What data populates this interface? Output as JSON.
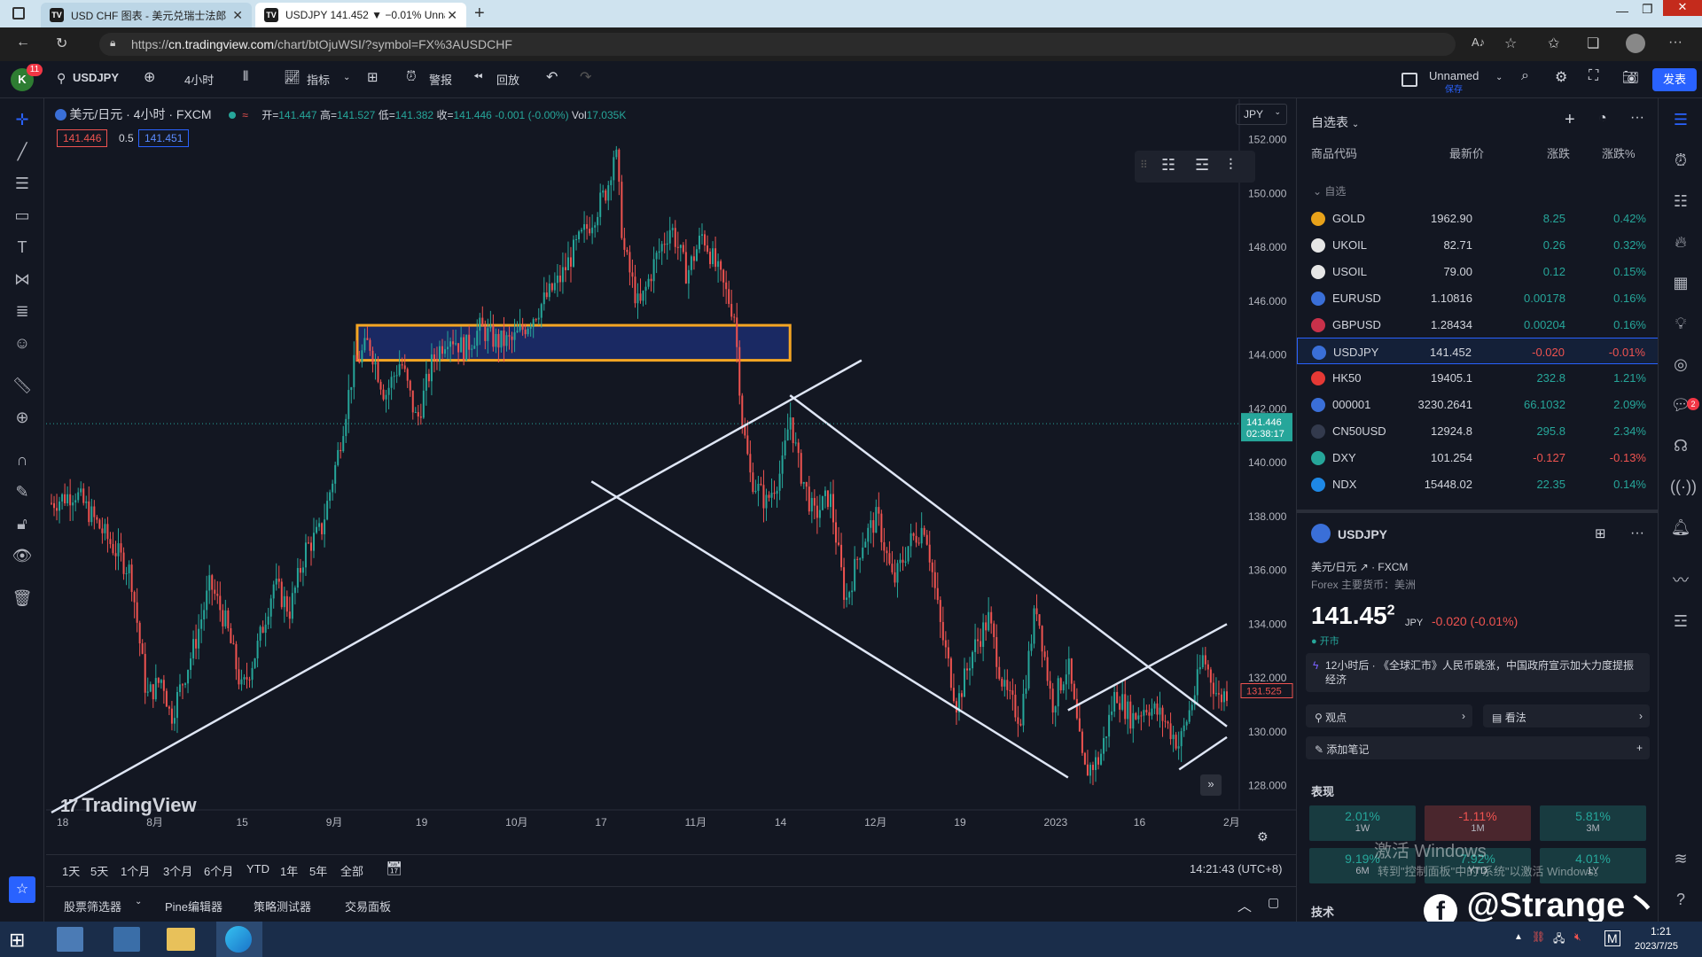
{
  "browser": {
    "tabs": [
      {
        "fav": "TV",
        "title": "USD CHF 图表 - 美元兑瑞士法郎"
      },
      {
        "fav": "TV",
        "title": "USDJPY 141.452 ▼ −0.01% Unna"
      }
    ],
    "url_pre": "https://",
    "url_host": "cn.tradingview.com",
    "url_path": "/chart/btOjuWSI/?symbol=FX%3AUSDCHF"
  },
  "toolbar": {
    "notif_count": "11",
    "symbol": "USDJPY",
    "interval": "4小时",
    "indicators": "指标",
    "alerts": "警报",
    "replay": "回放",
    "layout_name": "Unnamed",
    "layout_state": "保存",
    "publish": "发表",
    "avatar": "K"
  },
  "legend": {
    "title": "美元/日元 · 4小时 · FXCM",
    "o_label": "开=",
    "o": "141.447",
    "h_label": "高=",
    "h": "141.527",
    "l_label": "低=",
    "l": "141.382",
    "c_label": "收=",
    "c": "141.446",
    "chg": "-0.001 (-0.00%)",
    "vol_label": "Vol",
    "vol": "17.035K",
    "bid": "141.446",
    "spread": "0.5",
    "ask": "141.451",
    "currency": "JPY"
  },
  "chart_data": {
    "type": "candlestick",
    "symbol": "USDJPY",
    "timeframe": "4H",
    "y_ticks": [
      128.0,
      130.0,
      132.0,
      134.0,
      136.0,
      138.0,
      140.0,
      142.0,
      144.0,
      146.0,
      148.0,
      150.0,
      152.0
    ],
    "y_tick_labels": [
      "128.000",
      "130.000",
      "132.000",
      "134.000",
      "136.000",
      "138.000",
      "140.000",
      "142.000",
      "144.000",
      "146.000",
      "148.000",
      "150.000",
      "152.000"
    ],
    "ylim": [
      126.9,
      153.3
    ],
    "x_tick_labels": [
      "18",
      "8月",
      "15",
      "9月",
      "19",
      "10月",
      "17",
      "11月",
      "14",
      "12月",
      "19",
      "2023",
      "16",
      "2月"
    ],
    "price_path": [
      [
        0,
        138.5
      ],
      [
        3,
        138.9
      ],
      [
        7,
        137.2
      ],
      [
        10,
        135.9
      ],
      [
        12,
        131.3
      ],
      [
        14,
        132.0
      ],
      [
        15,
        130.5
      ],
      [
        18,
        133.2
      ],
      [
        20,
        135.5
      ],
      [
        22,
        134.0
      ],
      [
        24,
        131.5
      ],
      [
        26,
        133.2
      ],
      [
        28,
        135.5
      ],
      [
        30,
        134.5
      ],
      [
        32,
        136.8
      ],
      [
        34,
        137.5
      ],
      [
        36,
        140.2
      ],
      [
        38,
        143.5
      ],
      [
        40,
        144.5
      ],
      [
        42,
        142.5
      ],
      [
        44,
        143.8
      ],
      [
        46,
        141.5
      ],
      [
        48,
        143.8
      ],
      [
        50,
        144.8
      ],
      [
        52,
        144.2
      ],
      [
        54,
        145.0
      ],
      [
        56,
        144.5
      ],
      [
        58,
        144.5
      ],
      [
        60,
        145.2
      ],
      [
        62,
        146.0
      ],
      [
        64,
        146.8
      ],
      [
        66,
        148.0
      ],
      [
        68,
        149.0
      ],
      [
        70,
        150.2
      ],
      [
        71,
        151.8
      ],
      [
        72,
        148.0
      ],
      [
        74,
        145.7
      ],
      [
        76,
        147.5
      ],
      [
        78,
        148.8
      ],
      [
        80,
        147.0
      ],
      [
        82,
        148.5
      ],
      [
        84,
        147.0
      ],
      [
        86,
        145.5
      ],
      [
        87,
        141.5
      ],
      [
        88,
        139.5
      ],
      [
        90,
        138.5
      ],
      [
        92,
        139.8
      ],
      [
        93,
        141.8
      ],
      [
        94,
        140.0
      ],
      [
        96,
        138.0
      ],
      [
        98,
        138.8
      ],
      [
        100,
        134.8
      ],
      [
        102,
        137.0
      ],
      [
        104,
        138.0
      ],
      [
        106,
        135.5
      ],
      [
        108,
        137.0
      ],
      [
        110,
        137.7
      ],
      [
        112,
        133.8
      ],
      [
        114,
        131.0
      ],
      [
        116,
        133.0
      ],
      [
        118,
        134.2
      ],
      [
        120,
        131.5
      ],
      [
        122,
        130.5
      ],
      [
        124,
        134.8
      ],
      [
        126,
        131.0
      ],
      [
        128,
        132.5
      ],
      [
        130,
        128.5
      ],
      [
        132,
        129.0
      ],
      [
        134,
        131.5
      ],
      [
        136,
        130.5
      ],
      [
        138,
        131.0
      ],
      [
        140,
        130.5
      ],
      [
        142,
        129.5
      ],
      [
        144,
        131.5
      ],
      [
        145,
        132.8
      ],
      [
        147,
        131.2
      ],
      [
        148,
        131.52
      ]
    ],
    "x_max": 148,
    "last_price": "141.446",
    "last_countdown": "02:38:17",
    "prev_label": "131.525",
    "annotations": {
      "zone": {
        "from_x": 38.5,
        "to_x": 93,
        "y_low": 143.8,
        "y_high": 145.1,
        "border": "#f5a623",
        "fill": "#1c2d6e"
      },
      "trendline": {
        "x1": 0,
        "y1": 127.0,
        "x2": 102,
        "y2": 143.8
      },
      "channel_upper": {
        "x1": 93,
        "y1": 142.5,
        "x2": 148,
        "y2": 130.2
      },
      "channel_lower": {
        "x1": 68,
        "y1": 139.3,
        "x2": 128,
        "y2": 128.3
      },
      "wedge": [
        {
          "x1": 128,
          "y1": 130.8,
          "x2": 148,
          "y2": 134.0
        },
        {
          "x1": 142,
          "y1": 128.6,
          "x2": 148,
          "y2": 129.8
        }
      ]
    },
    "watermark": "TradingView"
  },
  "timeframes": [
    "1天",
    "5天",
    "1个月",
    "3个月",
    "6个月",
    "YTD",
    "1年",
    "5年",
    "全部"
  ],
  "clock": "14:21:43 (UTC+8)",
  "bottom_panels": [
    "股票筛选器",
    "Pine编辑器",
    "策略测试器",
    "交易面板"
  ],
  "watchlist": {
    "title": "自选表",
    "col_code": "商品代码",
    "col_last": "最新价",
    "col_chg": "涨跌",
    "col_pct": "涨跌%",
    "section": "自选",
    "rows": [
      {
        "sym": "GOLD",
        "last": "1962.90",
        "chg": "8.25",
        "pct": "0.42%",
        "dir": "up",
        "icon": "#e8a21a"
      },
      {
        "sym": "UKOIL",
        "last": "82.71",
        "chg": "0.26",
        "pct": "0.32%",
        "dir": "up",
        "icon": "#e6e6e6"
      },
      {
        "sym": "USOIL",
        "last": "79.00",
        "chg": "0.12",
        "pct": "0.15%",
        "dir": "up",
        "icon": "#e6e6e6"
      },
      {
        "sym": "EURUSD",
        "last": "1.10816",
        "chg": "0.00178",
        "pct": "0.16%",
        "dir": "up",
        "icon": "#3a6fd8"
      },
      {
        "sym": "GBPUSD",
        "last": "1.28434",
        "chg": "0.00204",
        "pct": "0.16%",
        "dir": "up",
        "icon": "#c8314a"
      },
      {
        "sym": "USDJPY",
        "last": "141.452",
        "chg": "-0.020",
        "pct": "-0.01%",
        "dir": "dn",
        "icon": "#3a6fd8"
      },
      {
        "sym": "HK50",
        "last": "19405.1",
        "chg": "232.8",
        "pct": "1.21%",
        "dir": "up",
        "icon": "#e53935"
      },
      {
        "sym": "000001",
        "last": "3230.2641",
        "chg": "66.1032",
        "pct": "2.09%",
        "dir": "up",
        "icon": "#3a6fd8"
      },
      {
        "sym": "CN50USD",
        "last": "12924.8",
        "chg": "295.8",
        "pct": "2.34%",
        "dir": "up",
        "icon": "#333a4d"
      },
      {
        "sym": "DXY",
        "last": "101.254",
        "chg": "-0.127",
        "pct": "-0.13%",
        "dir": "dn",
        "icon": "#26a69a"
      },
      {
        "sym": "NDX",
        "last": "15448.02",
        "chg": "22.35",
        "pct": "0.14%",
        "dir": "up",
        "icon": "#1e88e5"
      }
    ]
  },
  "details": {
    "symbol": "USDJPY",
    "desc": "美元/日元",
    "exchange": "FXCM",
    "category": "Forex 主要货币：美洲",
    "price": "141.45",
    "price_sup": "2",
    "cur": "JPY",
    "change": "-0.020 (-0.01%)",
    "status": "开市",
    "news": "12小时后 · 《全球汇市》人民币跳涨，中国政府宣示加大力度提振经济",
    "ideas": "观点",
    "opinions": "看法",
    "add_note": "添加笔记",
    "perf_title": "表现",
    "perf": [
      {
        "v": "2.01%",
        "p": "1W",
        "dir": "up"
      },
      {
        "v": "-1.11%",
        "p": "1M",
        "dir": "dn"
      },
      {
        "v": "5.81%",
        "p": "3M",
        "dir": "up"
      },
      {
        "v": "9.19%",
        "p": "6M",
        "dir": "up"
      },
      {
        "v": "7.92%",
        "p": "YTD",
        "dir": "up"
      },
      {
        "v": "4.01%",
        "p": "1Y",
        "dir": "up"
      }
    ],
    "tech": "技术"
  },
  "overlay": {
    "win_activate_1": "激活 Windows",
    "win_activate_2": "转到\"控制面板\"中的\"系统\"以激活 Windows。",
    "social": "@Strange丶"
  },
  "taskbar": {
    "time": "1:21",
    "date": "2023/7/25"
  },
  "colors": {
    "up": "#26a69a",
    "down": "#ef5350",
    "accent": "#2962ff",
    "candle_up": "#26a69a",
    "candle_dn": "#ef5350"
  }
}
